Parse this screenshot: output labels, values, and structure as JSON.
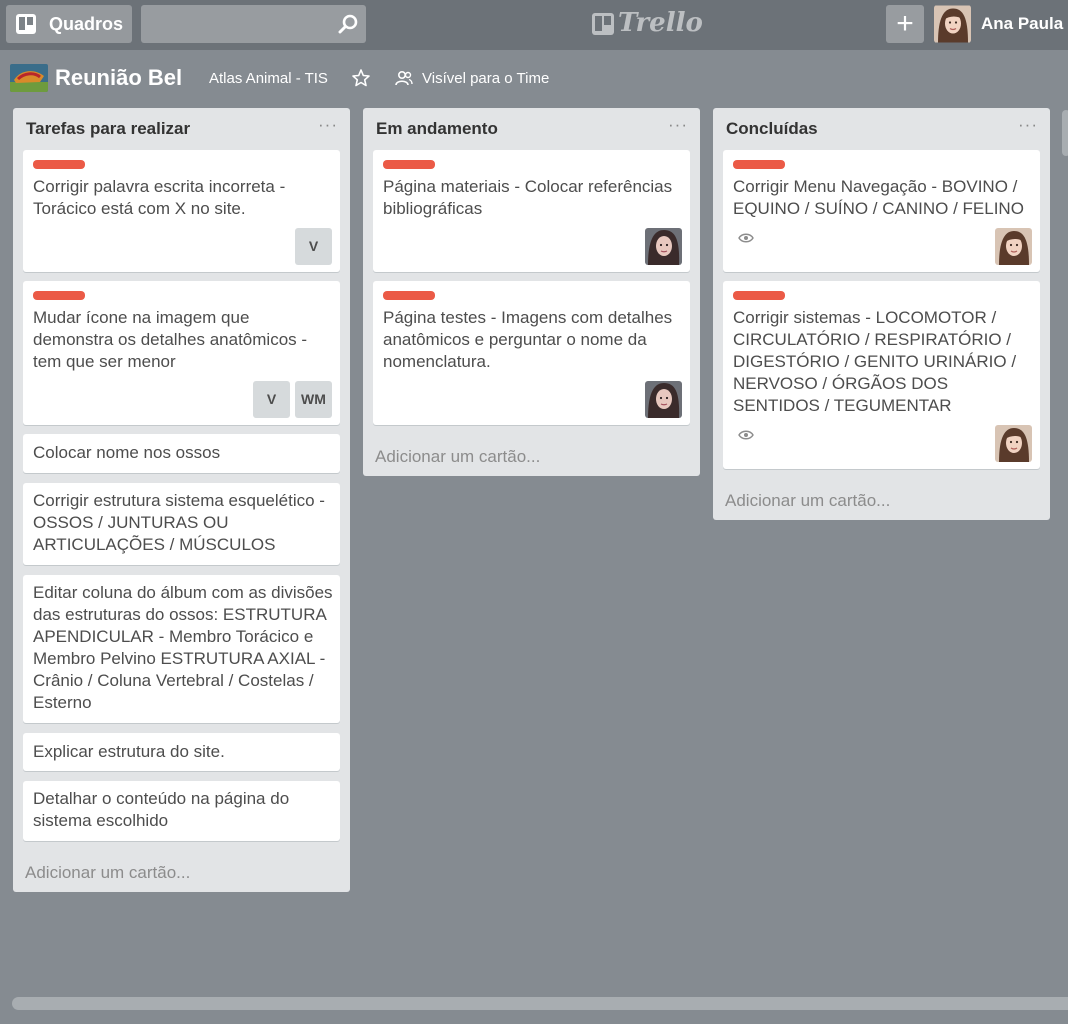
{
  "header": {
    "boards_label": "Quadros",
    "search_value": "",
    "logo_text": "Trello",
    "user_name": "Ana Paula"
  },
  "board": {
    "title": "Reunião Bel",
    "team": "Atlas Animal - TIS",
    "visibility": "Visível para o Time"
  },
  "lists": [
    {
      "title": "Tarefas para realizar",
      "add_card": "Adicionar um cartão...",
      "cards": [
        {
          "text": "Corrigir palavra escrita incorreta - Torácico está com X no site.",
          "label_color": "#eb5a46",
          "members": [
            "V"
          ]
        },
        {
          "text": "Mudar ícone na imagem que demonstra os detalhes anatômicos - tem que ser menor",
          "label_color": "#eb5a46",
          "members": [
            "V",
            "WM"
          ]
        },
        {
          "text": "Colocar nome nos ossos"
        },
        {
          "text": "Corrigir estrutura sistema esquelético - OSSOS / JUNTURAS OU ARTICULAÇÕES / MÚSCULOS"
        },
        {
          "text": "Editar coluna do álbum com as divisões das estruturas do ossos: ESTRUTURA APENDICULAR - Membro Torácico e Membro Pelvino ESTRUTURA AXIAL - Crânio / Coluna Vertebral / Costelas / Esterno"
        },
        {
          "text": "Explicar estrutura do site."
        },
        {
          "text": "Detalhar o conteúdo na página do sistema escolhido"
        }
      ]
    },
    {
      "title": "Em andamento",
      "add_card": "Adicionar um cartão...",
      "cards": [
        {
          "text": "Página materiais - Colocar referências bibliográficas",
          "label_color": "#eb5a46"
        },
        {
          "text": "Página testes - Imagens com detalhes anatômicos e perguntar o nome da nomenclatura.",
          "label_color": "#eb5a46"
        }
      ]
    },
    {
      "title": "Concluídas",
      "add_card": "Adicionar um cartão...",
      "cards": [
        {
          "text": "Corrigir Menu Navegação - BOVINO / EQUINO / SUÍNO / CANINO / FELINO",
          "label_color": "#eb5a46"
        },
        {
          "text": "Corrigir sistemas - LOCOMOTOR / CIRCULATÓRIO / RESPIRATÓRIO / DIGESTÓRIO / GENITO URINÁRIO / NERVOSO / ÓRGÃOS DOS SENTIDOS / TEGUMENTAR",
          "label_color": "#eb5a46"
        }
      ]
    }
  ],
  "icons": {
    "boards": "board-icon",
    "search": "search-icon",
    "add": "plus-icon",
    "star": "star-icon",
    "visibility": "team-icon",
    "watch": "eye-icon",
    "menu": "ellipsis-icon"
  }
}
